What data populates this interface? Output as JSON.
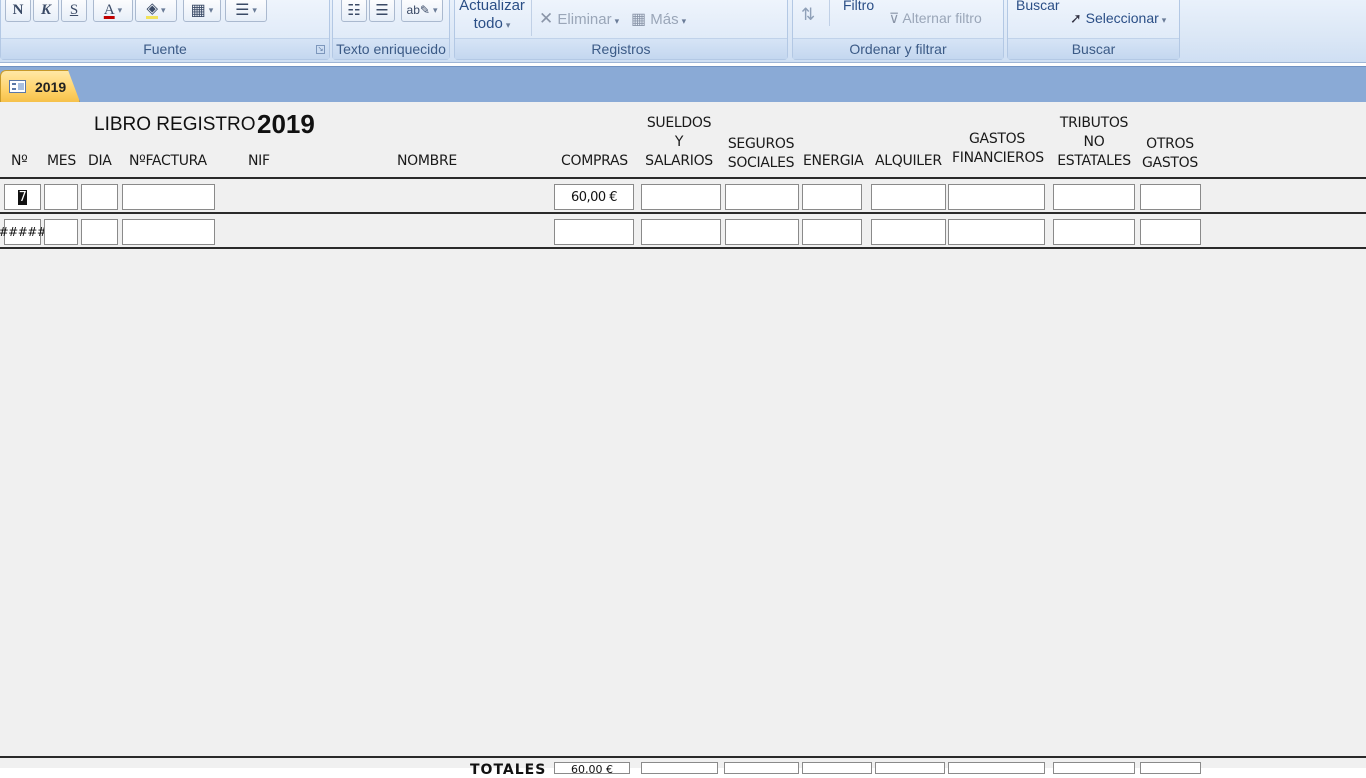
{
  "ribbon": {
    "fuente": {
      "label": "Fuente",
      "bold": "N",
      "italic": "K",
      "underline": "S",
      "font_color": "A"
    },
    "texto_enriquecido": {
      "label": "Texto enriquecido"
    },
    "registros": {
      "label": "Registros",
      "actualizar_line1": "Actualizar",
      "actualizar_line2": "todo",
      "eliminar": "Eliminar",
      "mas": "Más"
    },
    "ordenar": {
      "label": "Ordenar y filtrar",
      "filtro": "Filtro",
      "alternar": "Alternar filtro"
    },
    "buscar": {
      "label": "Buscar",
      "buscar": "Buscar",
      "seleccionar": "Seleccionar"
    }
  },
  "tab": {
    "label": "2019"
  },
  "form": {
    "title": "LIBRO REGISTRO",
    "year": "2019",
    "columns": {
      "n": "Nº",
      "mes": "MES",
      "dia": "DIA",
      "nfactura": "NºFACTURA",
      "nif": "NIF",
      "nombre": "NOMBRE",
      "compras": "COMPRAS",
      "sueldos_1": "SUELDOS",
      "sueldos_2": "Y",
      "sueldos_3": "SALARIOS",
      "seguros_1": "SEGUROS",
      "seguros_2": "SOCIALES",
      "energia": "ENERGIA",
      "alquiler": "ALQUILER",
      "gastos_1": "GASTOS",
      "gastos_2": "FINANCIEROS",
      "tributos_1": "TRIBUTOS",
      "tributos_2": "NO",
      "tributos_3": "ESTATALES",
      "otros_1": "OTROS",
      "otros_2": "GASTOS"
    },
    "row1": {
      "n": "7",
      "compras": "60,00 €"
    },
    "row2": {
      "n": "#####"
    },
    "totals": {
      "label": "TOTALES",
      "compras": "60,00 €"
    }
  },
  "colors": {
    "ribbon_text": "#3b5a86",
    "tab_active": "#ffd36a",
    "tabbar": "#8aaad6",
    "form_bg": "#f0f0f0"
  }
}
